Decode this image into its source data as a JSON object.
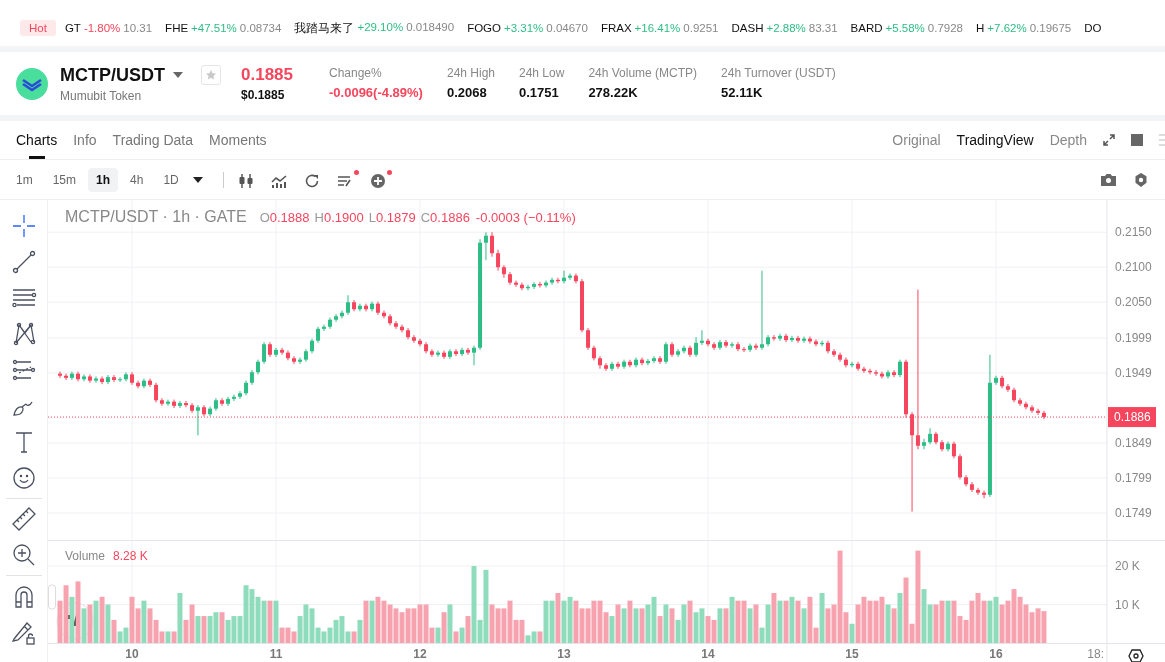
{
  "ticker": {
    "hot_label": "Hot",
    "items": [
      {
        "symbol": "GT",
        "change": "-1.80%",
        "price": "10.31",
        "down": true
      },
      {
        "symbol": "FHE",
        "change": "+47.51%",
        "price": "0.08734",
        "down": false
      },
      {
        "symbol": "我踏马来了",
        "change": "+29.10%",
        "price": "0.018490",
        "down": false
      },
      {
        "symbol": "FOGO",
        "change": "+3.31%",
        "price": "0.04670",
        "down": false
      },
      {
        "symbol": "FRAX",
        "change": "+16.41%",
        "price": "0.9251",
        "down": false
      },
      {
        "symbol": "DASH",
        "change": "+2.88%",
        "price": "83.31",
        "down": false
      },
      {
        "symbol": "BARD",
        "change": "+5.58%",
        "price": "0.7928",
        "down": false
      },
      {
        "symbol": "H",
        "change": "+7.62%",
        "price": "0.19675",
        "down": false
      },
      {
        "symbol": "DO"
      }
    ]
  },
  "pair": {
    "symbol": "MCTP/USDT",
    "name": "Mumubit Token",
    "favorite": false,
    "price": "0.1885",
    "price_usd": "$0.1885",
    "down": true,
    "stats": [
      {
        "label": "Change%",
        "value": "-0.0096(-4.89%)",
        "down": true
      },
      {
        "label": "24h High",
        "value": "0.2068",
        "down": false
      },
      {
        "label": "24h Low",
        "value": "0.1751",
        "down": false
      },
      {
        "label": "24h Volume (MCTP)",
        "value": "278.22K",
        "down": false
      },
      {
        "label": "24h Turnover (USDT)",
        "value": "52.11K",
        "down": false
      }
    ]
  },
  "tabs": [
    {
      "label": "Charts",
      "selected": true
    },
    {
      "label": "Info",
      "selected": false
    },
    {
      "label": "Trading Data",
      "selected": false
    },
    {
      "label": "Moments",
      "selected": false
    }
  ],
  "views": [
    {
      "label": "Original",
      "selected": false
    },
    {
      "label": "TradingView",
      "selected": true
    },
    {
      "label": "Depth",
      "selected": false
    }
  ],
  "intervals": [
    {
      "label": "1m",
      "selected": false
    },
    {
      "label": "15m",
      "selected": false
    },
    {
      "label": "1h",
      "selected": true
    },
    {
      "label": "4h",
      "selected": false
    },
    {
      "label": "1D",
      "selected": false
    }
  ],
  "chart_tools": [
    {
      "kind": "candles",
      "badge": false
    },
    {
      "kind": "indicators",
      "badge": false
    },
    {
      "kind": "replay",
      "badge": false
    },
    {
      "kind": "templates",
      "badge": true
    },
    {
      "kind": "add",
      "badge": true
    }
  ],
  "drawing_tools": [
    {
      "kind": "crosshair",
      "selected": true
    },
    {
      "kind": "trend-line",
      "selected": false
    },
    {
      "kind": "horizontal-lines",
      "selected": false
    },
    {
      "kind": "pattern",
      "selected": false
    },
    {
      "kind": "fib",
      "selected": false
    },
    {
      "kind": "brush",
      "selected": false
    },
    {
      "kind": "text",
      "selected": false
    },
    {
      "kind": "emoji",
      "selected": false
    },
    {
      "kind": "ruler",
      "selected": false
    },
    {
      "kind": "zoom",
      "selected": false
    },
    {
      "kind": "magnet",
      "selected": false
    },
    {
      "kind": "lock",
      "selected": false
    }
  ],
  "price": {
    "title": "MCTP/USDT · 1h · GATE",
    "down": true,
    "ohlc_legend": [
      {
        "key": "O",
        "value": "0.1888"
      },
      {
        "key": "H",
        "value": "0.1900"
      },
      {
        "key": "L",
        "value": "0.1879"
      },
      {
        "key": "C",
        "value": "0.1886"
      }
    ],
    "change": "-0.0003 (−0.11%)",
    "chart_data": {
      "type": "candlestick",
      "xlim": [
        9.4167,
        17.1736
      ],
      "ylim": [
        0.1709,
        0.2196
      ],
      "grid": true,
      "ref_lines": [
        {
          "axis": "y",
          "value": 0.1886,
          "label": "0.1886"
        }
      ],
      "yticks": [
        {
          "value": 0.215,
          "label": "0.2150"
        },
        {
          "value": 0.21,
          "label": "0.2100"
        },
        {
          "value": 0.205,
          "label": "0.2050"
        },
        {
          "value": 0.1999,
          "label": "0.1999"
        },
        {
          "value": 0.1949,
          "label": "0.1949"
        },
        {
          "value": 0.1849,
          "label": "0.1849"
        },
        {
          "value": 0.1799,
          "label": "0.1799"
        },
        {
          "value": 0.1749,
          "label": "0.1749"
        }
      ],
      "x": [
        9.5,
        9.542,
        9.583,
        9.625,
        9.667,
        9.708,
        9.75,
        9.792,
        9.833,
        9.875,
        9.917,
        9.958,
        10,
        10.042,
        10.083,
        10.125,
        10.167,
        10.208,
        10.25,
        10.292,
        10.333,
        10.375,
        10.417,
        10.458,
        10.5,
        10.542,
        10.583,
        10.625,
        10.667,
        10.708,
        10.75,
        10.792,
        10.833,
        10.875,
        10.917,
        10.958,
        11,
        11.042,
        11.083,
        11.125,
        11.167,
        11.208,
        11.25,
        11.292,
        11.333,
        11.375,
        11.417,
        11.458,
        11.5,
        11.542,
        11.583,
        11.625,
        11.667,
        11.708,
        11.75,
        11.792,
        11.833,
        11.875,
        11.917,
        11.958,
        12,
        12.042,
        12.083,
        12.125,
        12.167,
        12.208,
        12.25,
        12.292,
        12.333,
        12.375,
        12.417,
        12.458,
        12.5,
        12.542,
        12.583,
        12.625,
        12.667,
        12.708,
        12.75,
        12.792,
        12.833,
        12.875,
        12.917,
        12.958,
        13,
        13.042,
        13.083,
        13.125,
        13.167,
        13.208,
        13.25,
        13.292,
        13.333,
        13.375,
        13.417,
        13.458,
        13.5,
        13.542,
        13.583,
        13.625,
        13.667,
        13.708,
        13.75,
        13.792,
        13.833,
        13.875,
        13.917,
        13.958,
        14,
        14.042,
        14.083,
        14.125,
        14.167,
        14.208,
        14.25,
        14.292,
        14.333,
        14.375,
        14.417,
        14.458,
        14.5,
        14.542,
        14.583,
        14.625,
        14.667,
        14.708,
        14.75,
        14.792,
        14.833,
        14.875,
        14.917,
        14.958,
        15,
        15.042,
        15.083,
        15.125,
        15.167,
        15.208,
        15.25,
        15.292,
        15.333,
        15.375,
        15.417,
        15.458,
        15.5,
        15.542,
        15.583,
        15.625,
        15.667,
        15.708,
        15.75,
        15.792,
        15.833,
        15.875,
        15.917,
        15.958,
        16,
        16.042,
        16.083,
        16.125,
        16.167,
        16.208,
        16.25,
        16.292,
        16.333
      ],
      "ohlc": [
        [
          0.1948,
          0.1951,
          0.1942,
          0.1945
        ],
        [
          0.1945,
          0.1948,
          0.1939,
          0.1942
        ],
        [
          0.1942,
          0.1951,
          0.1939,
          0.1948
        ],
        [
          0.1948,
          0.1951,
          0.1937,
          0.194
        ],
        [
          0.194,
          0.1947,
          0.1937,
          0.1944
        ],
        [
          0.1944,
          0.1947,
          0.1935,
          0.1938
        ],
        [
          0.1938,
          0.1944,
          0.1935,
          0.1941
        ],
        [
          0.1941,
          0.1944,
          0.1933,
          0.1936
        ],
        [
          0.1936,
          0.1946,
          0.1933,
          0.1943
        ],
        [
          0.1943,
          0.1946,
          0.1936,
          0.1939
        ],
        [
          0.1939,
          0.1943,
          0.1936,
          0.194
        ],
        [
          0.194,
          0.195,
          0.1937,
          0.1947
        ],
        [
          0.1947,
          0.195,
          0.1932,
          0.1935
        ],
        [
          0.1935,
          0.1938,
          0.1927,
          0.193
        ],
        [
          0.193,
          0.1941,
          0.1927,
          0.1938
        ],
        [
          0.1938,
          0.1941,
          0.1929,
          0.1932
        ],
        [
          0.1932,
          0.1935,
          0.1907,
          0.191
        ],
        [
          0.191,
          0.1913,
          0.1902,
          0.1905
        ],
        [
          0.1905,
          0.1911,
          0.1902,
          0.1908
        ],
        [
          0.1908,
          0.1911,
          0.1899,
          0.1902
        ],
        [
          0.1902,
          0.1909,
          0.1899,
          0.1906
        ],
        [
          0.1906,
          0.1909,
          0.19,
          0.1903
        ],
        [
          0.1903,
          0.1906,
          0.1892,
          0.1895
        ],
        [
          0.1895,
          0.1903,
          0.186,
          0.19
        ],
        [
          0.19,
          0.1903,
          0.1887,
          0.189
        ],
        [
          0.189,
          0.1901,
          0.1887,
          0.1898
        ],
        [
          0.1898,
          0.1913,
          0.1895,
          0.191
        ],
        [
          0.191,
          0.1913,
          0.1902,
          0.1905
        ],
        [
          0.1905,
          0.1915,
          0.1902,
          0.1912
        ],
        [
          0.1912,
          0.1918,
          0.1909,
          0.1915
        ],
        [
          0.1915,
          0.1923,
          0.1912,
          0.192
        ],
        [
          0.192,
          0.1938,
          0.1917,
          0.1935
        ],
        [
          0.1935,
          0.1953,
          0.1932,
          0.195
        ],
        [
          0.195,
          0.1968,
          0.1947,
          0.1965
        ],
        [
          0.1965,
          0.1993,
          0.1962,
          0.199
        ],
        [
          0.199,
          0.1993,
          0.1972,
          0.1975
        ],
        [
          0.1975,
          0.1985,
          0.1972,
          0.1982
        ],
        [
          0.1982,
          0.1985,
          0.1975,
          0.1978
        ],
        [
          0.1978,
          0.1981,
          0.1967,
          0.197
        ],
        [
          0.197,
          0.1973,
          0.1962,
          0.1965
        ],
        [
          0.1965,
          0.1971,
          0.1962,
          0.1968
        ],
        [
          0.1968,
          0.1983,
          0.1965,
          0.198
        ],
        [
          0.198,
          0.1998,
          0.1977,
          0.1995
        ],
        [
          0.1995,
          0.2015,
          0.1992,
          0.2012
        ],
        [
          0.2012,
          0.2018,
          0.2009,
          0.2015
        ],
        [
          0.2015,
          0.2028,
          0.2012,
          0.2025
        ],
        [
          0.2025,
          0.2033,
          0.2022,
          0.203
        ],
        [
          0.203,
          0.2038,
          0.2027,
          0.2035
        ],
        [
          0.2035,
          0.206,
          0.2032,
          0.205
        ],
        [
          0.205,
          0.2053,
          0.2037,
          0.204
        ],
        [
          0.204,
          0.2048,
          0.2037,
          0.2045
        ],
        [
          0.2045,
          0.2048,
          0.2037,
          0.204
        ],
        [
          0.204,
          0.2051,
          0.2037,
          0.2048
        ],
        [
          0.2048,
          0.2051,
          0.2032,
          0.2035
        ],
        [
          0.2035,
          0.2038,
          0.2027,
          0.203
        ],
        [
          0.203,
          0.2033,
          0.2017,
          0.202
        ],
        [
          0.202,
          0.2023,
          0.2012,
          0.2015
        ],
        [
          0.2015,
          0.2018,
          0.2007,
          0.201
        ],
        [
          0.201,
          0.2013,
          0.1997,
          0.2
        ],
        [
          0.2,
          0.2003,
          0.1992,
          0.1995
        ],
        [
          0.1995,
          0.1998,
          0.1987,
          0.199
        ],
        [
          0.199,
          0.1993,
          0.1977,
          0.198
        ],
        [
          0.198,
          0.1983,
          0.1972,
          0.1975
        ],
        [
          0.1975,
          0.1981,
          0.1972,
          0.1978
        ],
        [
          0.1978,
          0.1981,
          0.1969,
          0.1972
        ],
        [
          0.1972,
          0.1983,
          0.1969,
          0.198
        ],
        [
          0.198,
          0.1983,
          0.1973,
          0.1976
        ],
        [
          0.1976,
          0.1985,
          0.1973,
          0.1982
        ],
        [
          0.1982,
          0.1985,
          0.1975,
          0.1978
        ],
        [
          0.1978,
          0.1988,
          0.196,
          0.1985
        ],
        [
          0.1985,
          0.214,
          0.1982,
          0.2135
        ],
        [
          0.2135,
          0.215,
          0.211,
          0.2145
        ],
        [
          0.2145,
          0.215,
          0.2115,
          0.212
        ],
        [
          0.212,
          0.2125,
          0.2095,
          0.21
        ],
        [
          0.21,
          0.2103,
          0.2085,
          0.209
        ],
        [
          0.209,
          0.2093,
          0.2075,
          0.2078
        ],
        [
          0.2078,
          0.2081,
          0.2072,
          0.2075
        ],
        [
          0.2075,
          0.2078,
          0.2067,
          0.207
        ],
        [
          0.207,
          0.2075,
          0.2067,
          0.2072
        ],
        [
          0.2072,
          0.2079,
          0.2069,
          0.2076
        ],
        [
          0.2076,
          0.2079,
          0.2071,
          0.2074
        ],
        [
          0.2074,
          0.2081,
          0.2071,
          0.2078
        ],
        [
          0.2078,
          0.2085,
          0.2075,
          0.2082
        ],
        [
          0.2082,
          0.2085,
          0.2077,
          0.208
        ],
        [
          0.208,
          0.2095,
          0.2077,
          0.2085
        ],
        [
          0.2085,
          0.2091,
          0.2082,
          0.2088
        ],
        [
          0.2088,
          0.2091,
          0.2077,
          0.208
        ],
        [
          0.208,
          0.2083,
          0.2007,
          0.201
        ],
        [
          0.201,
          0.2013,
          0.1982,
          0.1985
        ],
        [
          0.1985,
          0.1988,
          0.1967,
          0.197
        ],
        [
          0.197,
          0.1973,
          0.1955,
          0.196
        ],
        [
          0.196,
          0.1963,
          0.1952,
          0.1955
        ],
        [
          0.1955,
          0.1965,
          0.1952,
          0.1962
        ],
        [
          0.1962,
          0.1965,
          0.1955,
          0.1958
        ],
        [
          0.1958,
          0.1968,
          0.1955,
          0.1965
        ],
        [
          0.1965,
          0.1968,
          0.1957,
          0.196
        ],
        [
          0.196,
          0.1971,
          0.1957,
          0.1968
        ],
        [
          0.1968,
          0.1971,
          0.196,
          0.1963
        ],
        [
          0.1963,
          0.1969,
          0.196,
          0.1966
        ],
        [
          0.1966,
          0.1973,
          0.1963,
          0.197
        ],
        [
          0.197,
          0.1973,
          0.1962,
          0.1965
        ],
        [
          0.1965,
          0.1993,
          0.1962,
          0.199
        ],
        [
          0.199,
          0.1993,
          0.1972,
          0.1975
        ],
        [
          0.1975,
          0.1983,
          0.1972,
          0.198
        ],
        [
          0.198,
          0.1988,
          0.1977,
          0.1985
        ],
        [
          0.1985,
          0.1988,
          0.1972,
          0.1975
        ],
        [
          0.1975,
          0.2,
          0.1972,
          0.1992
        ],
        [
          0.1992,
          0.201,
          0.1989,
          0.1995
        ],
        [
          0.1995,
          0.1998,
          0.1987,
          0.199
        ],
        [
          0.199,
          0.1993,
          0.1982,
          0.1985
        ],
        [
          0.1985,
          0.1996,
          0.1982,
          0.1993
        ],
        [
          0.1993,
          0.1996,
          0.1985,
          0.1988
        ],
        [
          0.1988,
          0.1993,
          0.1985,
          0.199
        ],
        [
          0.199,
          0.1993,
          0.198,
          0.1983
        ],
        [
          0.1983,
          0.1986,
          0.1979,
          0.1982
        ],
        [
          0.1982,
          0.1991,
          0.1979,
          0.1988
        ],
        [
          0.1988,
          0.1991,
          0.1982,
          0.1985
        ],
        [
          0.1985,
          0.2095,
          0.1982,
          0.199
        ],
        [
          0.199,
          0.2003,
          0.1987,
          0.2
        ],
        [
          0.2,
          0.2003,
          0.1995,
          0.1998
        ],
        [
          0.1998,
          0.2005,
          0.1995,
          0.2002
        ],
        [
          0.2002,
          0.2005,
          0.1993,
          0.1996
        ],
        [
          0.1996,
          0.2002,
          0.1993,
          0.1999
        ],
        [
          0.1999,
          0.2002,
          0.1992,
          0.1995
        ],
        [
          0.1995,
          0.2001,
          0.1992,
          0.1998
        ],
        [
          0.1998,
          0.2001,
          0.1991,
          0.1994
        ],
        [
          0.1994,
          0.1997,
          0.1987,
          0.199
        ],
        [
          0.199,
          0.1995,
          0.1987,
          0.1992
        ],
        [
          0.1992,
          0.1995,
          0.1977,
          0.198
        ],
        [
          0.198,
          0.1983,
          0.1972,
          0.1975
        ],
        [
          0.1975,
          0.1978,
          0.1965,
          0.1968
        ],
        [
          0.1968,
          0.1971,
          0.1957,
          0.196
        ],
        [
          0.196,
          0.1965,
          0.1957,
          0.1962
        ],
        [
          0.1962,
          0.1965,
          0.1952,
          0.1955
        ],
        [
          0.1955,
          0.1958,
          0.1949,
          0.1952
        ],
        [
          0.1952,
          0.1955,
          0.1947,
          0.195
        ],
        [
          0.195,
          0.1953,
          0.1945,
          0.1948
        ],
        [
          0.1948,
          0.1951,
          0.1941,
          0.1944
        ],
        [
          0.1944,
          0.1953,
          0.1941,
          0.195
        ],
        [
          0.195,
          0.1953,
          0.1943,
          0.1946
        ],
        [
          0.1946,
          0.1968,
          0.1943,
          0.1965
        ],
        [
          0.1965,
          0.1968,
          0.1885,
          0.189
        ],
        [
          0.189,
          0.1893,
          0.1751,
          0.186
        ],
        [
          0.186,
          0.2068,
          0.184,
          0.1845
        ],
        [
          0.1845,
          0.1855,
          0.184,
          0.185
        ],
        [
          0.185,
          0.187,
          0.1847,
          0.1862
        ],
        [
          0.1862,
          0.1865,
          0.1847,
          0.185
        ],
        [
          0.185,
          0.1853,
          0.1837,
          0.184
        ],
        [
          0.184,
          0.1851,
          0.1837,
          0.1848
        ],
        [
          0.1848,
          0.1851,
          0.1827,
          0.183
        ],
        [
          0.183,
          0.1833,
          0.1797,
          0.18
        ],
        [
          0.18,
          0.1803,
          0.1787,
          0.179
        ],
        [
          0.179,
          0.1793,
          0.1779,
          0.1782
        ],
        [
          0.1782,
          0.1785,
          0.1775,
          0.1778
        ],
        [
          0.1778,
          0.1781,
          0.177,
          0.1775
        ],
        [
          0.1775,
          0.1975,
          0.1772,
          0.1935
        ],
        [
          0.1935,
          0.1945,
          0.1932,
          0.1942
        ],
        [
          0.1942,
          0.1945,
          0.1927,
          0.193
        ],
        [
          0.193,
          0.1933,
          0.1922,
          0.1925
        ],
        [
          0.1925,
          0.1928,
          0.1907,
          0.191
        ],
        [
          0.191,
          0.1913,
          0.1902,
          0.1905
        ],
        [
          0.1905,
          0.1908,
          0.1897,
          0.19
        ],
        [
          0.19,
          0.1903,
          0.1892,
          0.1895
        ],
        [
          0.1895,
          0.1898,
          0.1889,
          0.1892
        ],
        [
          0.1892,
          0.1895,
          0.1883,
          0.1886
        ]
      ]
    }
  },
  "volume": {
    "label": "Volume",
    "value": "8.28 K",
    "down": true,
    "edge_label": "18:",
    "chart_data": {
      "type": "bar",
      "xlim": [
        9.4167,
        17.1736
      ],
      "ylim": [
        0,
        26.5
      ],
      "grid": true,
      "yticks": [
        {
          "value": 20,
          "label": "20 K"
        },
        {
          "value": 10,
          "label": "10 K"
        }
      ],
      "xticks": [
        {
          "value": 10,
          "label": "10"
        },
        {
          "value": 11,
          "label": "11"
        },
        {
          "value": 12,
          "label": "12"
        },
        {
          "value": 13,
          "label": "13"
        },
        {
          "value": 14,
          "label": "14"
        },
        {
          "value": 15,
          "label": "15"
        },
        {
          "value": 16,
          "label": "16"
        }
      ],
      "x": [
        9.5,
        9.542,
        9.583,
        9.625,
        9.667,
        9.708,
        9.75,
        9.792,
        9.833,
        9.875,
        9.917,
        9.958,
        10,
        10.042,
        10.083,
        10.125,
        10.167,
        10.208,
        10.25,
        10.292,
        10.333,
        10.375,
        10.417,
        10.458,
        10.5,
        10.542,
        10.583,
        10.625,
        10.667,
        10.708,
        10.75,
        10.792,
        10.833,
        10.875,
        10.917,
        10.958,
        11,
        11.042,
        11.083,
        11.125,
        11.167,
        11.208,
        11.25,
        11.292,
        11.333,
        11.375,
        11.417,
        11.458,
        11.5,
        11.542,
        11.583,
        11.625,
        11.667,
        11.708,
        11.75,
        11.792,
        11.833,
        11.875,
        11.917,
        11.958,
        12,
        12.042,
        12.083,
        12.125,
        12.167,
        12.208,
        12.25,
        12.292,
        12.333,
        12.375,
        12.417,
        12.458,
        12.5,
        12.542,
        12.583,
        12.625,
        12.667,
        12.708,
        12.75,
        12.792,
        12.833,
        12.875,
        12.917,
        12.958,
        13,
        13.042,
        13.083,
        13.125,
        13.167,
        13.208,
        13.25,
        13.292,
        13.333,
        13.375,
        13.417,
        13.458,
        13.5,
        13.542,
        13.583,
        13.625,
        13.667,
        13.708,
        13.75,
        13.792,
        13.833,
        13.875,
        13.917,
        13.958,
        14,
        14.042,
        14.083,
        14.125,
        14.167,
        14.208,
        14.25,
        14.292,
        14.333,
        14.375,
        14.417,
        14.458,
        14.5,
        14.542,
        14.583,
        14.625,
        14.667,
        14.708,
        14.75,
        14.792,
        14.833,
        14.875,
        14.917,
        14.958,
        15,
        15.042,
        15.083,
        15.125,
        15.167,
        15.208,
        15.25,
        15.292,
        15.333,
        15.375,
        15.417,
        15.458,
        15.5,
        15.542,
        15.583,
        15.625,
        15.667,
        15.708,
        15.75,
        15.792,
        15.833,
        15.875,
        15.917,
        15.958,
        16,
        16.042,
        16.083,
        16.125,
        16.167,
        16.208,
        16.25,
        16.292,
        16.333
      ],
      "values": [
        11,
        15,
        12,
        16,
        9,
        10,
        11,
        12,
        10,
        6,
        3,
        4,
        12,
        9,
        11,
        9,
        6,
        3,
        3,
        3,
        13,
        6,
        10,
        7,
        7,
        7,
        8,
        8,
        6,
        7,
        7,
        15,
        14,
        12,
        11,
        11,
        11,
        4,
        4,
        3,
        7,
        10,
        9,
        4,
        3,
        4,
        6,
        7,
        3,
        3,
        6,
        11,
        11,
        12,
        11,
        10,
        9,
        8,
        9,
        9,
        10,
        10,
        4,
        4,
        8,
        10,
        3,
        4,
        7,
        20,
        6,
        19,
        10,
        9,
        9,
        11,
        6,
        6,
        2,
        3,
        3,
        11,
        11,
        13,
        11,
        12,
        11,
        9,
        9,
        11,
        11,
        8,
        7,
        10,
        9,
        11,
        9,
        9,
        10,
        12,
        7,
        10,
        9,
        6,
        10,
        11,
        8,
        9,
        7,
        6,
        9,
        9,
        12,
        11,
        11,
        9,
        10,
        4,
        10,
        13,
        11,
        11,
        12,
        11,
        9,
        12,
        4,
        13,
        9,
        10,
        24,
        8,
        5,
        10,
        12,
        11,
        11,
        12,
        10,
        9,
        13,
        17,
        5,
        24,
        14,
        10,
        10,
        11,
        11,
        11,
        7,
        6,
        11,
        13,
        11,
        11,
        12,
        10,
        11,
        14,
        12,
        10,
        8,
        9,
        8.28
      ]
    }
  }
}
